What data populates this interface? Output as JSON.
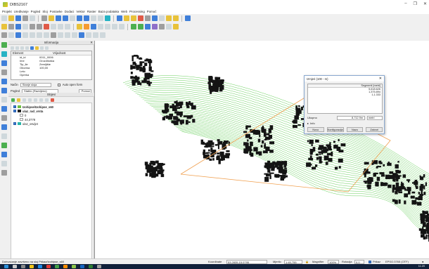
{
  "window": {
    "title": "DIBS2167",
    "minimize_icon": "–",
    "maximize_icon": "❐",
    "close_icon": "✕"
  },
  "menu": [
    "Projekt",
    "Uređivanje",
    "Pogled",
    "Sloj",
    "Postavke",
    "Dodaci",
    "Vektor",
    "Raster",
    "Baza podataka",
    "Web",
    "Processing",
    "Pomoć"
  ],
  "identify": {
    "title": "Informacija",
    "close": "✕",
    "columns": [
      "Element",
      "Vrijednost"
    ],
    "rows": [
      {
        "name": "id_id",
        "value": "0011_0006"
      },
      {
        "name": "Ime",
        "value": "Grozdiluška"
      },
      {
        "name": "Tip_ile",
        "value": "Zemljište"
      },
      {
        "name": "Oborina",
        "value": "100,00"
      },
      {
        "name": "Leto",
        "value": ""
      },
      {
        "name": "Opreka",
        "value": ""
      }
    ],
    "mode_label": "Način",
    "mode_value": "Stanje sloja",
    "auto_open_label": "Auto open form",
    "view_label": "Pogled",
    "view_value": "Stablo (Razvijeno)",
    "help_label": "Pomoć"
  },
  "layers": {
    "title": "Slojevi",
    "items": [
      {
        "label": "Izohipse/Izohipse_s60",
        "checked": true,
        "color": "#6fbf40"
      },
      {
        "label": "ulaz_rad_vrsta",
        "checked": true,
        "color": "#222222"
      },
      {
        "label": "0",
        "checked": false,
        "color": "#ffffff"
      },
      {
        "label": "44,3778",
        "checked": false,
        "color": "#ffffff"
      },
      {
        "label": "ulaz_osvijet",
        "checked": true,
        "color": "#26b5a8"
      }
    ]
  },
  "measure": {
    "title": "Izmjeri (100 - m)",
    "close": "✕",
    "column_header": "Segmenti [metri]",
    "segments": [
      "5,618.626",
      "1,375.894",
      "1,1.333"
    ],
    "total_label": "Ukupno",
    "total_value": "8,712.9m",
    "unit": "metri",
    "info_label": "Info",
    "buttons": [
      "Novo",
      "Konfiguracija",
      "Nazo",
      "Zatvori"
    ]
  },
  "status": {
    "message": "Dohvaćanje završeno na sloj Prikaz/Izohipse_s60",
    "coord_label": "Koordinate",
    "coord_value": "53.2835,15.0795",
    "scale_label": "Mjerilo",
    "scale_value": "1:45,755",
    "magnify_label": "Magnifier",
    "magnify_value": "100%",
    "rotation_label": "Rotacija",
    "rotation_value": "0,0",
    "render_label": "Prikaz",
    "crs_label": "EPSG:3765 (OTF)"
  },
  "taskbar": {
    "clock": "11:20"
  },
  "colors": {
    "contour": "#57c94a",
    "measure_line": "#f0a050",
    "raster": "#141414"
  }
}
